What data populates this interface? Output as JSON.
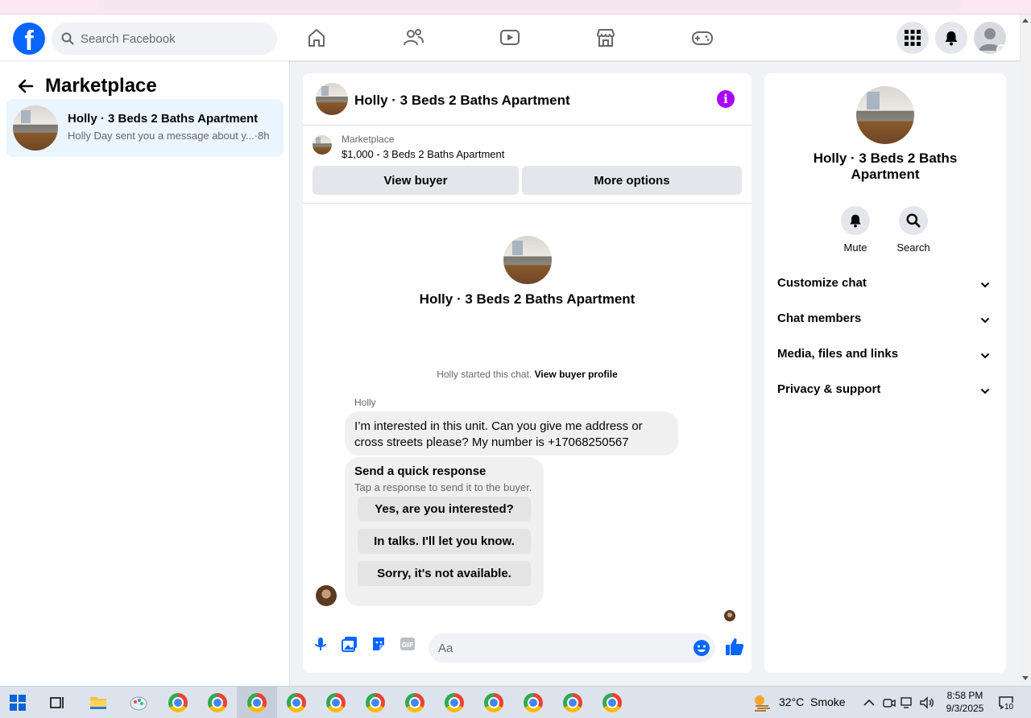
{
  "search": {
    "placeholder": "Search Facebook"
  },
  "left_panel": {
    "title": "Marketplace",
    "conversation": {
      "title": "Holly · 3 Beds 2 Baths Apartment",
      "preview": "Holly Day sent you a message about y...·8h"
    }
  },
  "chat": {
    "title": "Holly · 3 Beds 2 Baths Apartment",
    "listing_label": "Marketplace",
    "listing_price": "$1,000 - 3 Beds 2 Baths Apartment",
    "view_buyer_label": "View buyer",
    "more_options_label": "More options",
    "center_title": "Holly · 3 Beds 2 Baths Apartment",
    "started_text": "Holly started this chat.",
    "view_profile_link": "View buyer profile",
    "sender_name": "Holly",
    "message_line1": "I’m interested in this unit. Can you give me address or",
    "message_line2": "cross streets please?  My number is +17068250567",
    "quick_response": {
      "title": "Send a quick response",
      "subtitle": "Tap a response to send it to the buyer.",
      "options": [
        "Yes, are you interested?",
        "In talks. I'll let you know.",
        "Sorry, it's not available."
      ]
    },
    "composer_placeholder": "Aa"
  },
  "info_panel": {
    "title": "Holly · 3 Beds 2 Baths Apartment",
    "mute_label": "Mute",
    "search_label": "Search",
    "sections": [
      "Customize chat",
      "Chat members",
      "Media, files and links",
      "Privacy & support"
    ]
  },
  "taskbar": {
    "temperature": "32°C",
    "weather": "Smoke",
    "time": "8:58 PM",
    "date": "9/3/2025",
    "notification_count": "10"
  },
  "colors": {
    "brand_blue": "#0866ff",
    "info_purple": "#a900ff",
    "selected_row": "#ebf5ff"
  },
  "icons": [
    "home-icon",
    "friends-icon",
    "video-icon",
    "marketplace-icon",
    "gaming-icon",
    "menu-grid-icon",
    "bell-icon",
    "mic-icon",
    "photo-icon",
    "sticker-icon",
    "gif-icon",
    "emoji-icon",
    "like-icon"
  ]
}
